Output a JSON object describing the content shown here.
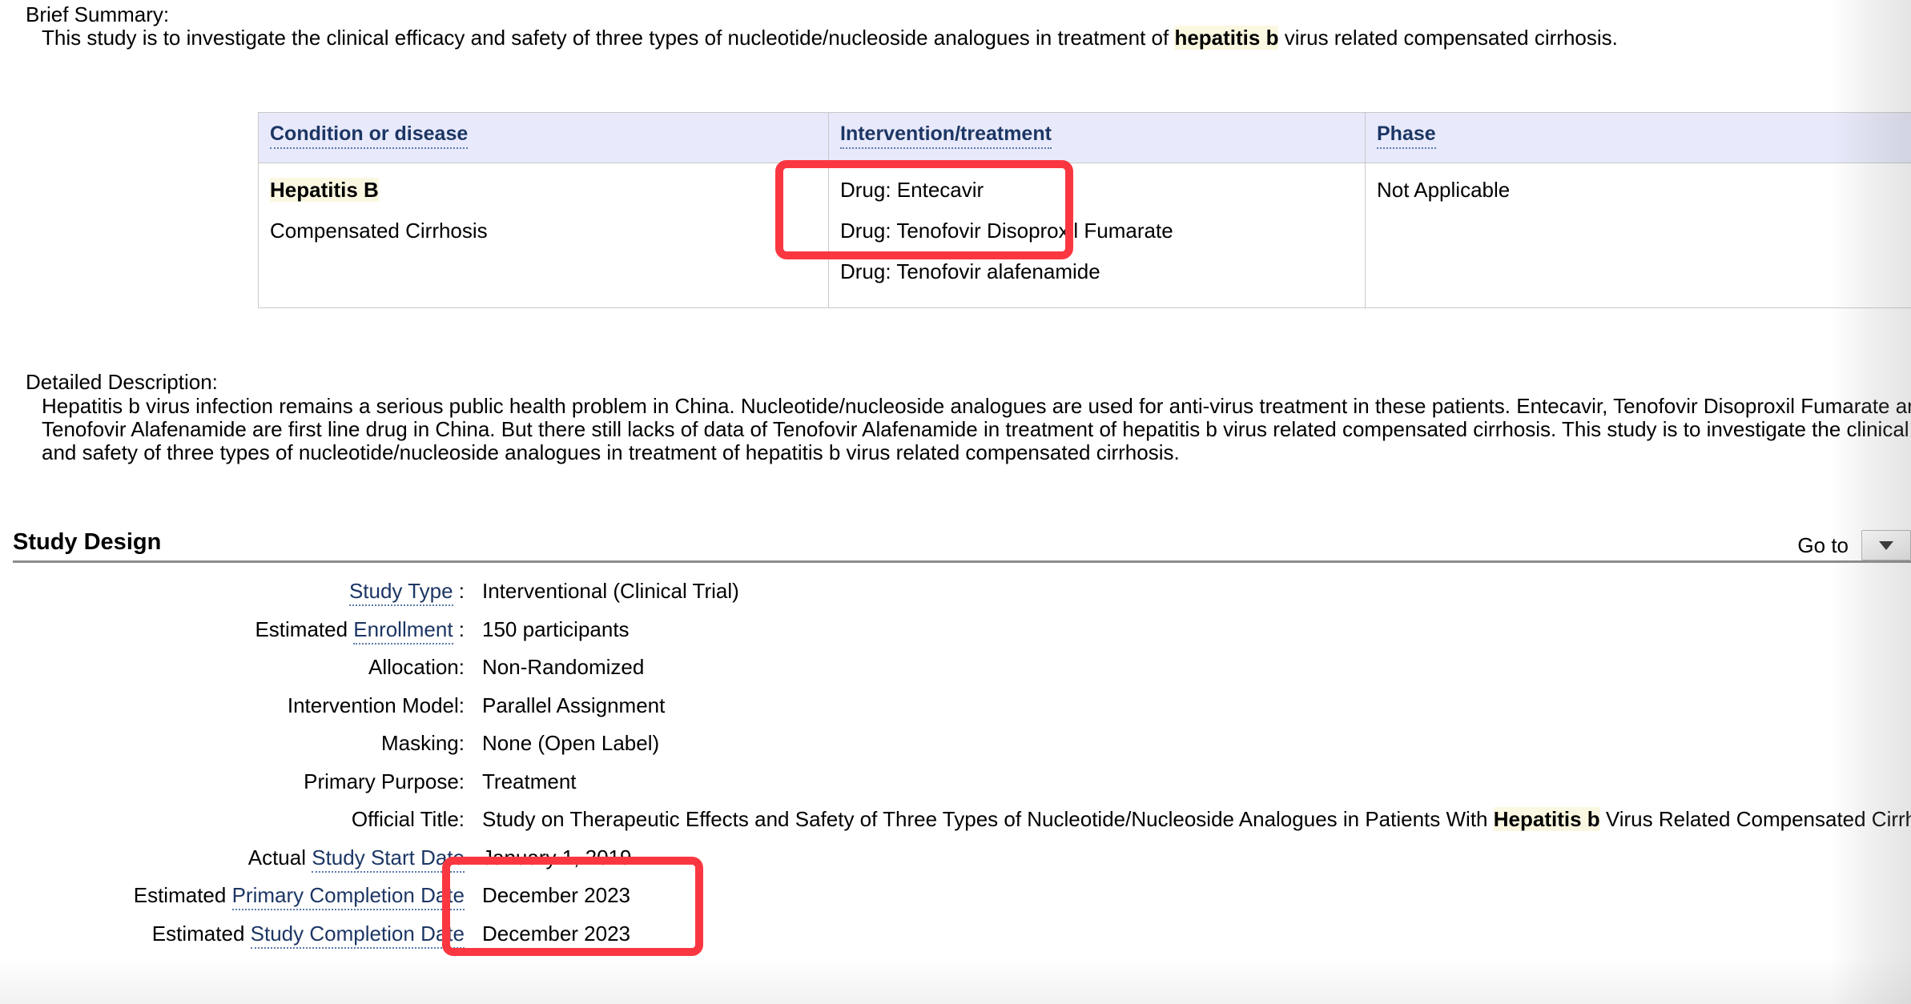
{
  "brief_summary": {
    "label": "Brief Summary:",
    "text_before_highlight": "This study is to investigate the clinical efficacy and safety of three types of nucleotide/nucleoside analogues in treatment of ",
    "highlight": "hepatitis b",
    "text_after_highlight": " virus related compensated cirrhosis."
  },
  "conditions_table": {
    "headers": [
      "Condition or disease",
      "Intervention/treatment",
      "Phase"
    ],
    "condition_cells": [
      {
        "text": "Hepatitis B",
        "highlighted": true
      },
      {
        "text": "Compensated Cirrhosis",
        "highlighted": false
      }
    ],
    "intervention_cells": [
      "Drug: Entecavir",
      "Drug: Tenofovir Disoproxil Fumarate",
      "Drug: Tenofovir alafenamide"
    ],
    "phase_cells": [
      "Not Applicable"
    ]
  },
  "detailed_description": {
    "label": "Detailed Description:",
    "lines": [
      "Hepatitis b virus infection remains a serious public health problem in China. Nucleotide/nucleoside analogues are used for anti-virus treatment in these patients. Entecavir, Tenofovir Disoproxil Fumarate and",
      "Tenofovir Alafenamide are first line drug in China. But there still lacks of data of Tenofovir Alafenamide in treatment of hepatitis b virus related compensated cirrhosis. This study is to investigate the clinical efficacy",
      "and safety of three types of nucleotide/nucleoside analogues in treatment of hepatitis b virus related compensated cirrhosis."
    ]
  },
  "study_design": {
    "title": "Study Design",
    "goto_label": "Go to",
    "rows": [
      {
        "prefix": "",
        "link": "Study Type",
        "suffix": " :",
        "value": "Interventional  (Clinical Trial)"
      },
      {
        "prefix": "Estimated ",
        "link": "Enrollment",
        "suffix": " :",
        "value": "150 participants"
      },
      {
        "prefix": "Allocation:",
        "link": "",
        "suffix": "",
        "value": "Non-Randomized"
      },
      {
        "prefix": "Intervention Model:",
        "link": "",
        "suffix": "",
        "value": "Parallel Assignment"
      },
      {
        "prefix": "Masking:",
        "link": "",
        "suffix": "",
        "value": "None (Open Label)"
      },
      {
        "prefix": "Primary Purpose:",
        "link": "",
        "suffix": "",
        "value": "Treatment"
      },
      {
        "prefix": "Official Title:",
        "link": "",
        "suffix": "",
        "value": "Study on Therapeutic Effects and Safety of Three Types of Nucleotide/Nucleoside Analogues in Patients With ",
        "value_highlight": "Hepatitis b",
        "value_tail": " Virus Related Compensated Cirrhosis"
      },
      {
        "prefix": "Actual ",
        "link": "Study Start Date",
        "suffix": "",
        "value": "January 1, 2019"
      },
      {
        "prefix": "Estimated ",
        "link": "Primary Completion Date",
        "suffix": "",
        "value": "December 2023"
      },
      {
        "prefix": "Estimated ",
        "link": "Study Completion Date",
        "suffix": "",
        "value": "December 2023"
      }
    ]
  },
  "annotations": {
    "red_box_color": "#fa3741",
    "highlight_color": "#fbf8e1",
    "link_color": "#1c3664",
    "table_header_bg": "#e8eafb"
  }
}
